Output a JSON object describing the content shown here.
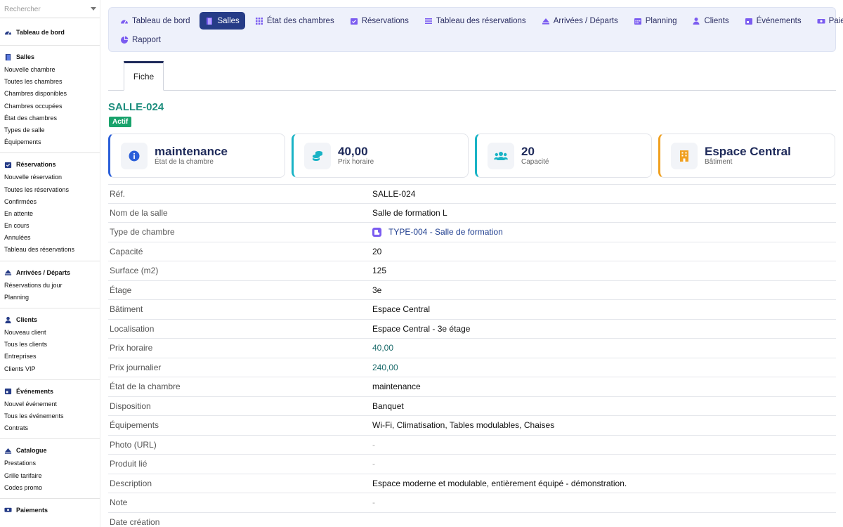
{
  "search": {
    "placeholder": "Rechercher"
  },
  "sidebar": {
    "dashboard": {
      "label": "Tableau de bord"
    },
    "sections": [
      {
        "title": "Salles",
        "items": [
          "Nouvelle chambre",
          "Toutes les chambres",
          "Chambres disponibles",
          "Chambres occupées",
          "État des chambres",
          "Types de salle",
          "Équipements"
        ]
      },
      {
        "title": "Réservations",
        "items": [
          "Nouvelle réservation",
          "Toutes les réservations",
          "Confirmées",
          "En attente",
          "En cours",
          "Annulées",
          "Tableau des réservations"
        ]
      },
      {
        "title": "Arrivées / Départs",
        "items": [
          "Réservations du jour",
          "Planning"
        ]
      },
      {
        "title": "Clients",
        "items": [
          "Nouveau client",
          "Tous les clients",
          "Entreprises",
          "Clients VIP"
        ]
      },
      {
        "title": "Événements",
        "items": [
          "Nouvel événement",
          "Tous les événements",
          "Contrats"
        ]
      },
      {
        "title": "Catalogue",
        "items": [
          "Prestations",
          "Grille tarifaire",
          "Codes promo"
        ]
      },
      {
        "title": "Paiements",
        "items": []
      }
    ]
  },
  "nav": {
    "items": [
      "Tableau de bord",
      "Salles",
      "État des chambres",
      "Réservations",
      "Tableau des réservations",
      "Arrivées / Départs",
      "Planning",
      "Clients",
      "Événements",
      "Paiements",
      "Rapport"
    ]
  },
  "tabs": {
    "fiche": "Fiche"
  },
  "record": {
    "title": "SALLE-024",
    "status": "Actif"
  },
  "cards": [
    {
      "value": "maintenance",
      "label": "État de la chambre",
      "accent": "#2b5fd9"
    },
    {
      "value": "40,00",
      "label": "Prix horaire",
      "accent": "#19b3c5"
    },
    {
      "value": "20",
      "label": "Capacité",
      "accent": "#19b3c5"
    },
    {
      "value": "Espace Central",
      "label": "Bâtiment",
      "accent": "#f0a020"
    }
  ],
  "fields": [
    {
      "label": "Réf.",
      "value": "SALLE-024"
    },
    {
      "label": "Nom de la salle",
      "value": "Salle de formation L"
    },
    {
      "label": "Type de chambre",
      "value": "TYPE-004 - Salle de formation"
    },
    {
      "label": "Capacité",
      "value": "20"
    },
    {
      "label": "Surface (m2)",
      "value": "125"
    },
    {
      "label": "Étage",
      "value": "3e"
    },
    {
      "label": "Bâtiment",
      "value": "Espace Central"
    },
    {
      "label": "Localisation",
      "value": "Espace Central - 3e étage"
    },
    {
      "label": "Prix horaire",
      "value": "40,00"
    },
    {
      "label": "Prix journalier",
      "value": "240,00"
    },
    {
      "label": "État de la chambre",
      "value": "maintenance"
    },
    {
      "label": "Disposition",
      "value": "Banquet"
    },
    {
      "label": "Équipements",
      "value": "Wi-Fi, Climatisation, Tables modulables, Chaises"
    },
    {
      "label": "Photo (URL)",
      "value": "-"
    },
    {
      "label": "Produit lié",
      "value": "-"
    },
    {
      "label": "Description",
      "value": "Espace moderne et modulable, entièrement équipé - démonstration."
    },
    {
      "label": "Note",
      "value": "-"
    },
    {
      "label": "Date création",
      "value": ""
    }
  ],
  "colors": {
    "brand": "#263c87",
    "title": "#1e8e7e",
    "badge": "#19a36c",
    "icon": "#7b5cf0"
  }
}
